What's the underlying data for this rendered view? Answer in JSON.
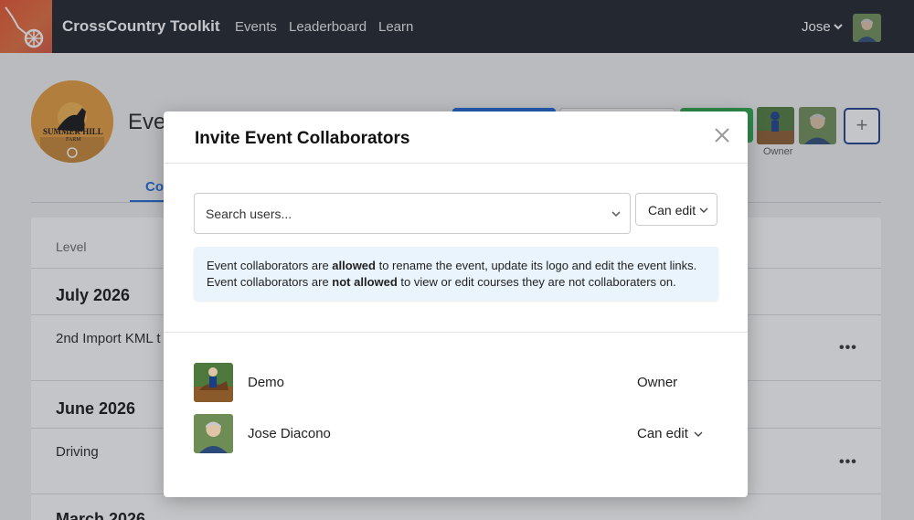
{
  "topbar": {
    "brand": "CrossCountry Toolkit",
    "nav": [
      "Events",
      "Leaderboard",
      "Learn"
    ],
    "user_name": "Jose",
    "logo_icon": "wheel-cart-logo"
  },
  "page": {
    "event_title_partial": "Eve",
    "event_logo_text": "SUMMER HILL",
    "event_logo_sub": "FARM",
    "tab_partial": "Co",
    "owner_label": "Owner",
    "plus_label": "+",
    "list": {
      "header": "Level",
      "months": [
        {
          "label": "July 2026",
          "items": [
            "2nd Import KML t"
          ]
        },
        {
          "label": "June 2026",
          "items": [
            "Driving"
          ]
        },
        {
          "label": "March 2026",
          "items": []
        }
      ],
      "more_label": "•••"
    }
  },
  "modal": {
    "title": "Invite Event Collaborators",
    "close_icon": "close-icon",
    "search_placeholder": "Search users...",
    "permission_selected": "Can edit",
    "info": {
      "line1_a": "Event collaborators are ",
      "line1_b": "allowed",
      "line1_c": " to rename the event, update its logo and edit the event links.",
      "line2_a": "Event collaborators are ",
      "line2_b": "not allowed",
      "line2_c": " to view or edit courses they are not collaboraters on."
    },
    "members": [
      {
        "name": "Demo",
        "role": "Owner",
        "editable": false
      },
      {
        "name": "Jose Diacono",
        "role": "Can edit",
        "editable": true
      }
    ]
  },
  "colors": {
    "nav_bg": "#1b1f27",
    "logo_orange": "#e8502a",
    "primary_blue": "#1a66d8",
    "success_green": "#2aa84a",
    "info_bg": "#eaf4fc"
  }
}
